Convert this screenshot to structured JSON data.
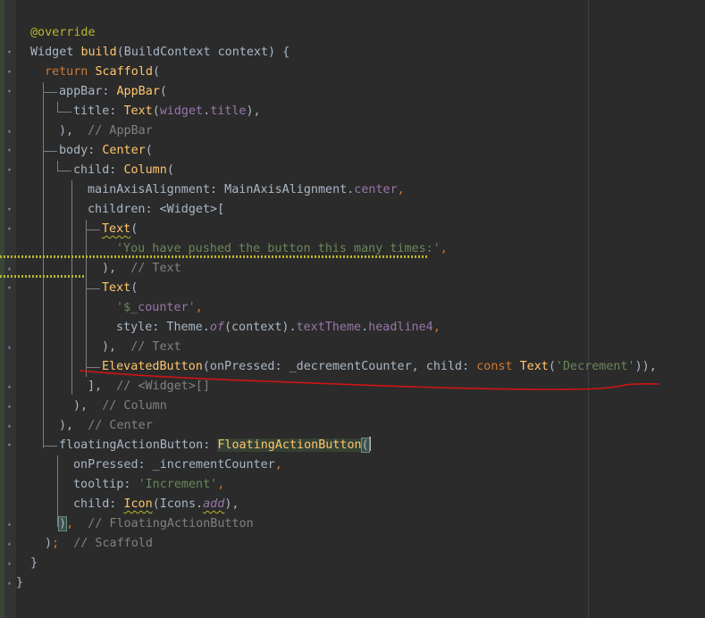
{
  "colors": {
    "background": "#2b2b2b",
    "keyword": "#cc7832",
    "class": "#ffc66d",
    "field": "#9876aa",
    "string": "#6a8759",
    "comment": "#808080",
    "annotation": "#bbb529",
    "plain": "#a9b7c6",
    "red_pen": "#d11414"
  },
  "code": {
    "l1_ann": "@override",
    "l2_a": "Widget ",
    "l2_b": "build",
    "l2_c": "(BuildContext context) {",
    "l3_kw": "return ",
    "l3_cls": "Scaffold",
    "l3_p": "(",
    "l4_a": "appBar: ",
    "l4_b": "AppBar",
    "l4_c": "(",
    "l5_a": "title: ",
    "l5_b": "Text",
    "l5_c": "(",
    "l5_d": "widget",
    "l5_e": ".",
    "l5_f": "title",
    "l5_g": "),",
    "l6_a": "),",
    "l6_c": "  // AppBar",
    "l7_a": "body: ",
    "l7_b": "Center",
    "l7_c": "(",
    "l8_a": "child: ",
    "l8_b": "Column",
    "l8_c": "(",
    "l9_a": "mainAxisAlignment: MainAxisAlignment.",
    "l9_b": "center",
    "l9_c": ",",
    "l10_a": "children: <Widget>[",
    "l11_a": "Text",
    "l11_b": "(",
    "l12_a": "'You have pushed the button this many times:'",
    "l12_b": ",",
    "l13_a": "),",
    "l13_c": "  // Text",
    "l14_a": "Text",
    "l14_b": "(",
    "l15_a": "'$",
    "l15_b": "_counter",
    "l15_c": "'",
    "l15_d": ",",
    "l16_a": "style: Theme.",
    "l16_b": "of",
    "l16_c": "(context).",
    "l16_d": "textTheme",
    "l16_e": ".",
    "l16_f": "headline4",
    "l16_g": ",",
    "l17_a": "),",
    "l17_c": "  // Text",
    "l18_a": "ElevatedButton",
    "l18_b": "(onPressed: _decrementCounter, child: ",
    "l18_c": "const ",
    "l18_d": "Text",
    "l18_e": "(",
    "l18_f": "'Decrement'",
    "l18_g": ")),",
    "l19_a": "],",
    "l19_c": "  // <Widget>[]",
    "l20_a": "),",
    "l20_c": "  // Column",
    "l21_a": "),",
    "l21_c": "  // Center",
    "l22_a": "floatingActionButton: ",
    "l22_b": "FloatingActionButton",
    "l22_c": "(",
    "l23_a": "onPressed: _incrementCounter",
    "l23_b": ",",
    "l24_a": "tooltip: ",
    "l24_b": "'Increment'",
    "l24_c": ",",
    "l25_a": "child: ",
    "l25_b": "Icon",
    "l25_c": "(Icons.",
    "l25_d": "add",
    "l25_e": "),",
    "l26_a": ")",
    "l26_b": ",",
    "l26_c": "  // FloatingActionButton",
    "l27_a": ")",
    "l27_b": ";",
    "l27_c": "  // Scaffold",
    "l28_a": "}",
    "l29_a": "}"
  },
  "gutter_icons": [
    "fold-icon"
  ]
}
